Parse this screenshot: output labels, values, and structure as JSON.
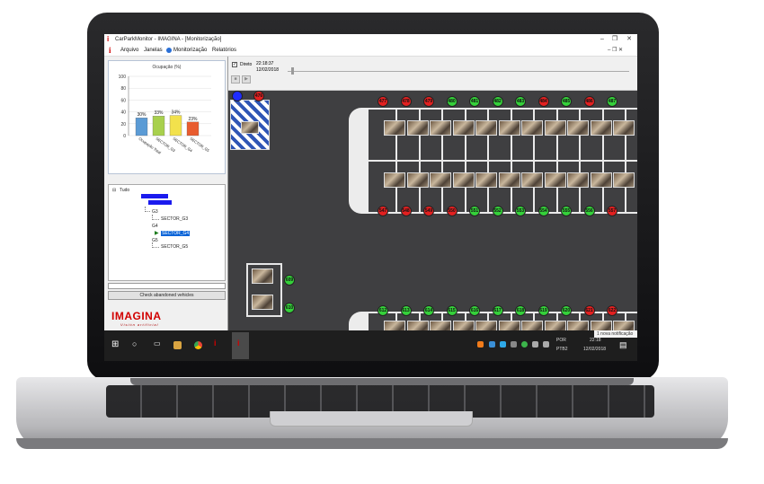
{
  "app": {
    "window_title": "CarParkMonitor - IMAGINA - [Monitorização]",
    "window_buttons": {
      "minimize": "–",
      "restore": "❐",
      "close": "✕"
    },
    "menu": [
      "Arquivo",
      "Janelas",
      "Monitorização",
      "Relatórios"
    ]
  },
  "controls": {
    "direto_label": "Direto",
    "time": "22:18:37",
    "date": "12/02/2018"
  },
  "chart_data": {
    "type": "bar",
    "title": "Ocupação (%)",
    "categories": [
      "Ocupação Total",
      "SECTOR_G3",
      "SECTOR_G4",
      "SECTOR_G5"
    ],
    "values": [
      30,
      33,
      34,
      23
    ],
    "value_labels": [
      "30%",
      "33%",
      "34%",
      "23%"
    ],
    "colors": [
      "#5b9bd5",
      "#a8d04d",
      "#f2e14c",
      "#e85c2f"
    ],
    "ylim": [
      0,
      100
    ],
    "yticks": [
      "0",
      "20",
      "40",
      "60",
      "80",
      "100"
    ]
  },
  "tree": {
    "root": "Tudo",
    "groups": [
      {
        "label": "G3",
        "child": "SECTOR_G3"
      },
      {
        "label": "G4",
        "child": "SECTOR_G4",
        "selected": true
      },
      {
        "label": "G5",
        "child": "SECTOR_G5"
      }
    ]
  },
  "sidebar": {
    "check_button": "Check abandoned vehicles",
    "logo": "IMAGINA",
    "tagline": "Visión artificial"
  },
  "parking": {
    "top_left_badges": [
      {
        "label": "",
        "status": "blue"
      },
      {
        "label": "476",
        "status": "busy"
      }
    ],
    "row1_top": [
      {
        "label": "477",
        "status": "busy"
      },
      {
        "label": "478",
        "status": "busy"
      },
      {
        "label": "479",
        "status": "busy"
      },
      {
        "label": "480",
        "status": "free"
      },
      {
        "label": "481",
        "status": "free"
      },
      {
        "label": "482",
        "status": "free"
      },
      {
        "label": "483",
        "status": "free"
      },
      {
        "label": "484",
        "status": "busy"
      },
      {
        "label": "485",
        "status": "free"
      },
      {
        "label": "486",
        "status": "busy"
      },
      {
        "label": "487",
        "status": "free"
      }
    ],
    "row1_bottom": [
      {
        "label": "547",
        "status": "busy"
      },
      {
        "label": "548",
        "status": "busy"
      },
      {
        "label": "549",
        "status": "busy"
      },
      {
        "label": "550",
        "status": "busy"
      },
      {
        "label": "551",
        "status": "free"
      },
      {
        "label": "552",
        "status": "free"
      },
      {
        "label": "553",
        "status": "free"
      },
      {
        "label": "554",
        "status": "free"
      },
      {
        "label": "555",
        "status": "free"
      },
      {
        "label": "556",
        "status": "free"
      },
      {
        "label": "557",
        "status": "busy"
      }
    ],
    "side_spots": [
      {
        "label": "609",
        "status": "free"
      },
      {
        "label": "610",
        "status": "free"
      }
    ],
    "row2_top": [
      {
        "label": "612",
        "status": "free"
      },
      {
        "label": "613",
        "status": "free"
      },
      {
        "label": "614",
        "status": "free"
      },
      {
        "label": "615",
        "status": "free"
      },
      {
        "label": "616",
        "status": "free"
      },
      {
        "label": "617",
        "status": "free"
      },
      {
        "label": "618",
        "status": "free"
      },
      {
        "label": "619",
        "status": "free"
      },
      {
        "label": "620",
        "status": "free"
      },
      {
        "label": "621",
        "status": "busy"
      },
      {
        "label": "622",
        "status": "busy"
      }
    ]
  },
  "taskbar": {
    "language": "POR",
    "keyboard": "PTB2",
    "time": "22:18",
    "date": "12/02/2018",
    "notification": "1 nova notificação"
  },
  "colors": {
    "free": "#35d13a",
    "busy": "#e32020",
    "brand": "#d10000"
  }
}
